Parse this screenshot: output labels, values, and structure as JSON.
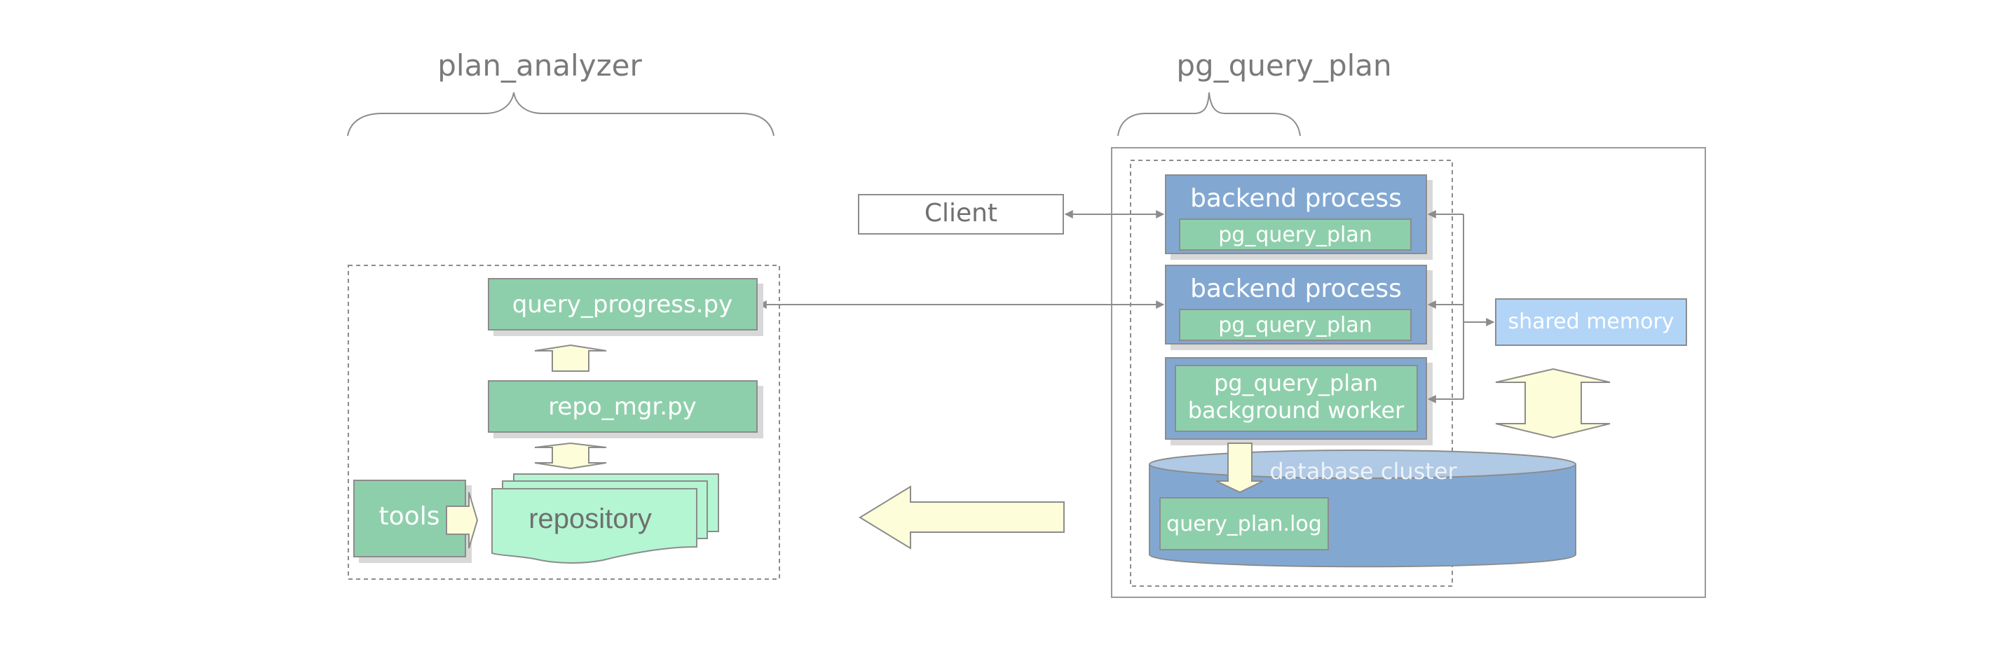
{
  "diagram": {
    "groups": {
      "plan_analyzer": {
        "title": "plan_analyzer"
      },
      "pg_query_plan": {
        "title": "pg_query_plan"
      }
    },
    "nodes": {
      "client": "Client",
      "backend_1": {
        "title": "backend process",
        "module": "pg_query_plan"
      },
      "backend_2": {
        "title": "backend process",
        "module": "pg_query_plan"
      },
      "bg_worker": {
        "line1": "pg_query_plan",
        "line2": "background worker"
      },
      "shared_memory": "shared memory",
      "database_cluster": "database cluster",
      "query_plan_log": "query_plan.log",
      "query_progress": "query_progress.py",
      "repo_mgr": "repo_mgr.py",
      "tools": "tools",
      "repository": "repository"
    },
    "edges": [
      {
        "from": "client",
        "to": "backend_1",
        "type": "bidirectional"
      },
      {
        "from": "query_progress",
        "to": "backend_2",
        "type": "bidirectional"
      },
      {
        "from": "shared_memory",
        "to": "backend_1",
        "type": "directed"
      },
      {
        "from": "shared_memory",
        "to": "backend_2",
        "type": "directed"
      },
      {
        "from": "shared_memory",
        "to": "bg_worker",
        "type": "directed"
      },
      {
        "from": "bg_worker",
        "to": "query_plan_log",
        "type": "block-arrow"
      },
      {
        "from": "shared_memory",
        "to": "database_cluster",
        "type": "block-double-arrow"
      },
      {
        "from": "database_cluster",
        "to": "plan_analyzer",
        "type": "block-arrow"
      },
      {
        "from": "repo_mgr",
        "to": "query_progress",
        "type": "block-arrow"
      },
      {
        "from": "repository",
        "to": "repo_mgr",
        "type": "block-double-arrow"
      },
      {
        "from": "tools",
        "to": "repository",
        "type": "block-arrow"
      }
    ],
    "colors": {
      "blue_box": "#82a8d2",
      "green_box": "#8ecfab",
      "light_green": "#b4f5d2",
      "shared_memory": "#b2d5f7",
      "cylinder_top": "#b0c9e4",
      "arrow_fill": "#fdfdd9",
      "stroke": "#8c8c8c",
      "title_text": "#7a7a7a"
    }
  }
}
